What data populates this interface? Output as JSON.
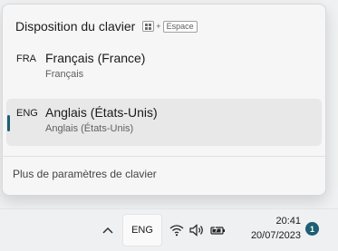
{
  "flyout": {
    "title": "Disposition du clavier",
    "shortcut": {
      "plus": "+",
      "key": "Espace"
    },
    "languages": [
      {
        "code": "FRA",
        "name": "Français (France)",
        "sub": "Français",
        "selected": false
      },
      {
        "code": "ENG",
        "name": "Anglais (États-Unis)",
        "sub": "Anglais (États-Unis)",
        "selected": true
      }
    ],
    "more_link": "Plus de paramètres de clavier"
  },
  "taskbar": {
    "lang": "ENG",
    "time": "20:41",
    "date": "20/07/2023",
    "notification_count": "1"
  },
  "colors": {
    "accent": "#1c5f73"
  },
  "icons": [
    "chevron-up-icon",
    "wifi-icon",
    "speaker-icon",
    "battery-icon",
    "windows-key-icon"
  ]
}
